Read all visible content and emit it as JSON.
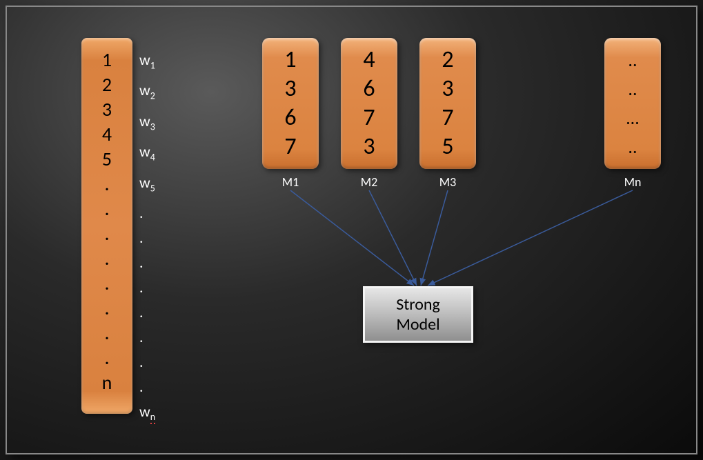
{
  "left_items": {
    "r1": "1",
    "r2": "2",
    "r3": "3",
    "r4": "4",
    "r5": "5",
    "d1": ".",
    "d2": ".",
    "d3": ".",
    "d4": ".",
    "d5": ".",
    "d6": ".",
    "d7": ".",
    "d8": ".",
    "rn": "n"
  },
  "weights": {
    "w1b": "w",
    "w1s": "1",
    "w2b": "w",
    "w2s": "2",
    "w3b": "w",
    "w3s": "3",
    "w4b": "w",
    "w4s": "4",
    "w5b": "w",
    "w5s": "5",
    "d1": ".",
    "d2": ".",
    "d3": ".",
    "d4": ".",
    "d5": ".",
    "d6": ".",
    "d7": ".",
    "d8": ".",
    "wnb": "w",
    "wns": "n"
  },
  "models": {
    "m1": {
      "v1": "1",
      "v2": "3",
      "v3": "6",
      "v4": "7",
      "label": "M1"
    },
    "m2": {
      "v1": "4",
      "v2": "6",
      "v3": "7",
      "v4": "3",
      "label": "M2"
    },
    "m3": {
      "v1": "2",
      "v2": "3",
      "v3": "7",
      "v4": "5",
      "label": "M3"
    },
    "mn": {
      "v1": "..",
      "v2": "..",
      "v3": "…",
      "v4": "..",
      "label": "Mn"
    }
  },
  "strong": {
    "line1": "Strong",
    "line2": "Model"
  }
}
